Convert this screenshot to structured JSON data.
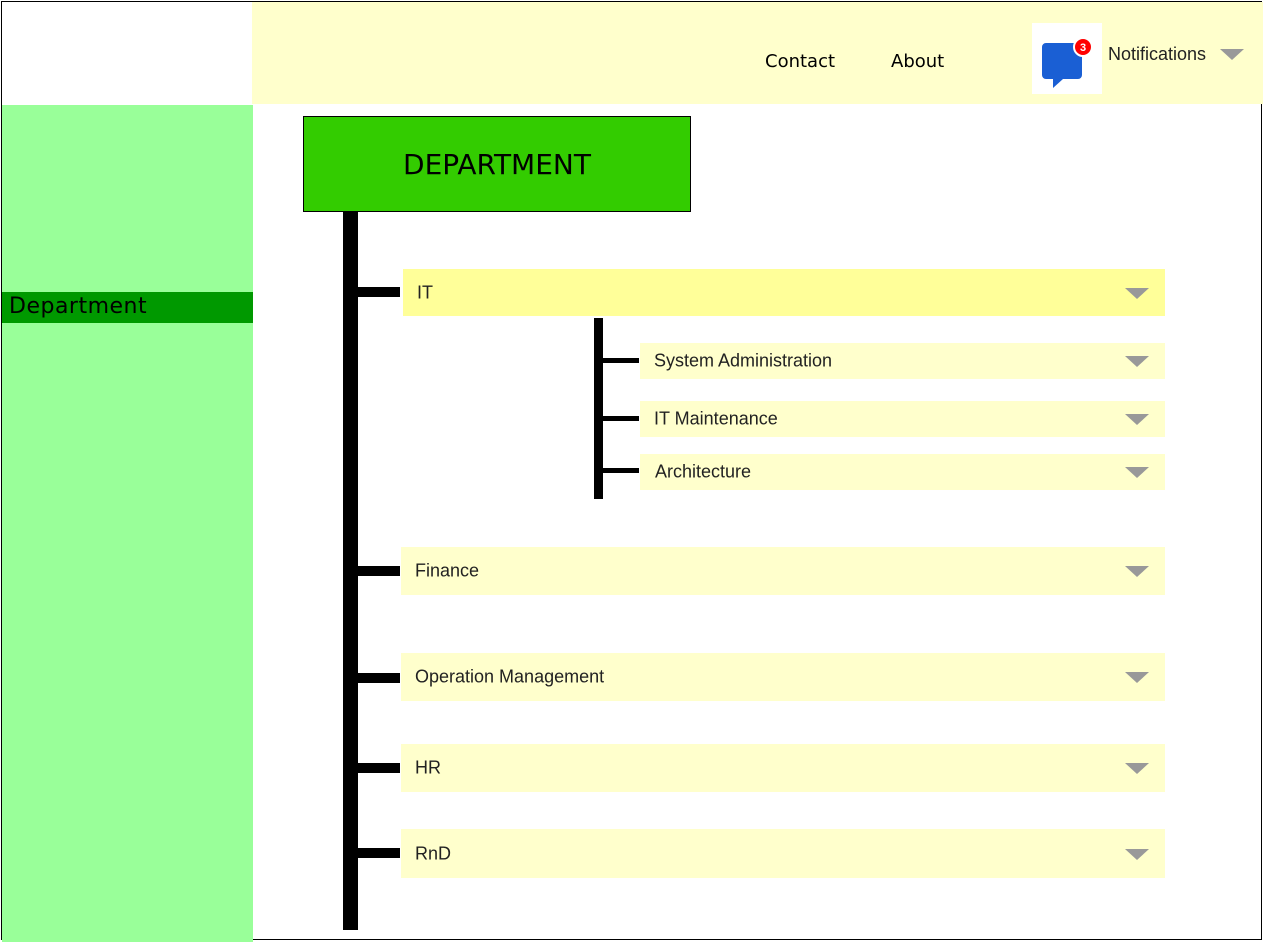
{
  "header": {
    "nav": {
      "contact": "Contact",
      "about": "About"
    },
    "notifications": {
      "label": "Notifications",
      "count": "3"
    }
  },
  "sidebar": {
    "items": [
      {
        "label": "Department"
      }
    ]
  },
  "main": {
    "title": "DEPARTMENT",
    "departments": [
      {
        "label": "IT",
        "expanded": true,
        "children": [
          {
            "label": "System Administration"
          },
          {
            "label": "IT Maintenance"
          },
          {
            "label": "Architecture"
          }
        ]
      },
      {
        "label": "Finance"
      },
      {
        "label": "Operation Management"
      },
      {
        "label": "HR"
      },
      {
        "label": "RnD"
      }
    ]
  },
  "colors": {
    "header_bg": "#ffffcc",
    "sidebar_bg": "#99ff99",
    "sidebar_active": "#009900",
    "title_box": "#33cc00",
    "row_bg": "#ffffcc",
    "row_active": "#ffff99",
    "badge": "#ff0000",
    "chat_icon": "#1a5fd4"
  },
  "icons": {
    "notifications": "chat-bubble-icon",
    "dropdown": "caret-down-icon"
  }
}
